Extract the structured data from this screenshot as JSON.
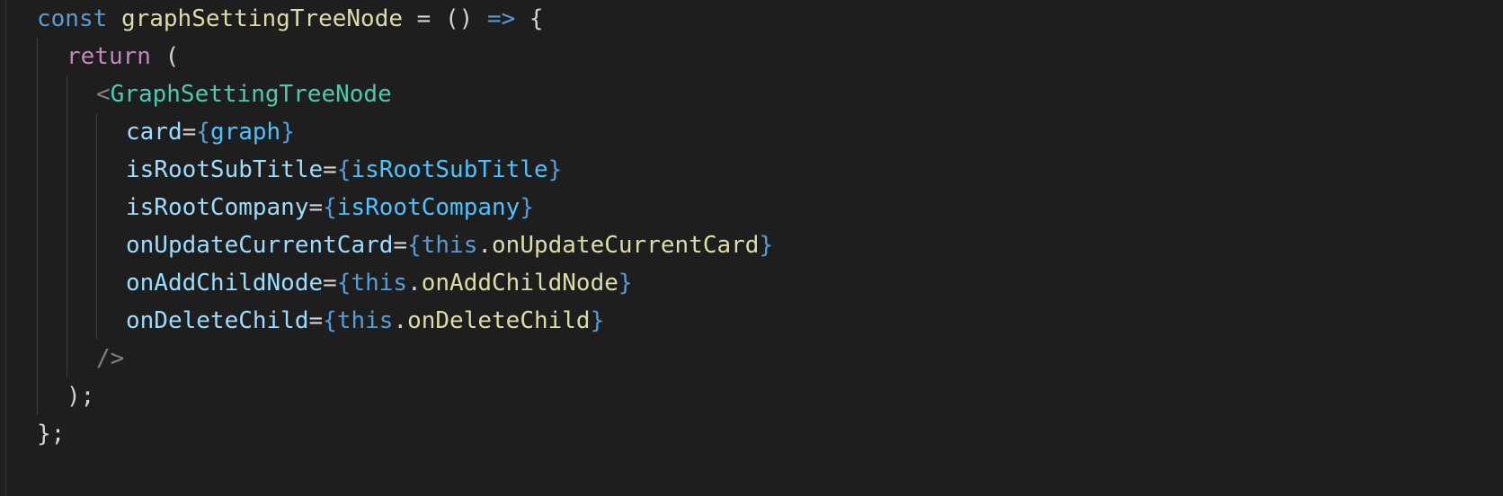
{
  "editor": {
    "colors": {
      "background": "#1e1e1e",
      "keyword_blue": "#569cd6",
      "keyword_purple": "#c586c0",
      "function_yellow": "#dcdcaa",
      "component_teal": "#4ec9b0",
      "attribute_lightblue": "#9cdcfe",
      "brace_blue": "#569cd6",
      "punctuation": "#d4d4d4",
      "tag_bracket": "#808080"
    },
    "lines": [
      {
        "indent": 0,
        "tokens": [
          {
            "text": "const",
            "color": "#569cd6"
          },
          {
            "text": " ",
            "color": "#d4d4d4"
          },
          {
            "text": "graphSettingTreeNode",
            "color": "#dcdcaa"
          },
          {
            "text": " = () ",
            "color": "#d4d4d4"
          },
          {
            "text": "=>",
            "color": "#569cd6"
          },
          {
            "text": " {",
            "color": "#d4d4d4"
          }
        ]
      },
      {
        "indent": 1,
        "tokens": [
          {
            "text": "return",
            "color": "#c586c0"
          },
          {
            "text": " (",
            "color": "#d4d4d4"
          }
        ]
      },
      {
        "indent": 2,
        "tokens": [
          {
            "text": "<",
            "color": "#808080"
          },
          {
            "text": "GraphSettingTreeNode",
            "color": "#4ec9b0"
          }
        ]
      },
      {
        "indent": 3,
        "tokens": [
          {
            "text": "card",
            "color": "#9cdcfe"
          },
          {
            "text": "=",
            "color": "#d4d4d4"
          },
          {
            "text": "{",
            "color": "#569cd6"
          },
          {
            "text": "graph",
            "color": "#4fc1ff"
          },
          {
            "text": "}",
            "color": "#569cd6"
          }
        ]
      },
      {
        "indent": 3,
        "tokens": [
          {
            "text": "isRootSubTitle",
            "color": "#9cdcfe"
          },
          {
            "text": "=",
            "color": "#d4d4d4"
          },
          {
            "text": "{",
            "color": "#569cd6"
          },
          {
            "text": "isRootSubTitle",
            "color": "#4fc1ff"
          },
          {
            "text": "}",
            "color": "#569cd6"
          }
        ]
      },
      {
        "indent": 3,
        "tokens": [
          {
            "text": "isRootCompany",
            "color": "#9cdcfe"
          },
          {
            "text": "=",
            "color": "#d4d4d4"
          },
          {
            "text": "{",
            "color": "#569cd6"
          },
          {
            "text": "isRootCompany",
            "color": "#4fc1ff"
          },
          {
            "text": "}",
            "color": "#569cd6"
          }
        ]
      },
      {
        "indent": 3,
        "tokens": [
          {
            "text": "onUpdateCurrentCard",
            "color": "#9cdcfe"
          },
          {
            "text": "=",
            "color": "#d4d4d4"
          },
          {
            "text": "{",
            "color": "#569cd6"
          },
          {
            "text": "this",
            "color": "#569cd6"
          },
          {
            "text": ".",
            "color": "#d4d4d4"
          },
          {
            "text": "onUpdateCurrentCard",
            "color": "#dcdcaa"
          },
          {
            "text": "}",
            "color": "#569cd6"
          }
        ]
      },
      {
        "indent": 3,
        "tokens": [
          {
            "text": "onAddChildNode",
            "color": "#9cdcfe"
          },
          {
            "text": "=",
            "color": "#d4d4d4"
          },
          {
            "text": "{",
            "color": "#569cd6"
          },
          {
            "text": "this",
            "color": "#569cd6"
          },
          {
            "text": ".",
            "color": "#d4d4d4"
          },
          {
            "text": "onAddChildNode",
            "color": "#dcdcaa"
          },
          {
            "text": "}",
            "color": "#569cd6"
          }
        ]
      },
      {
        "indent": 3,
        "tokens": [
          {
            "text": "onDeleteChild",
            "color": "#9cdcfe"
          },
          {
            "text": "=",
            "color": "#d4d4d4"
          },
          {
            "text": "{",
            "color": "#569cd6"
          },
          {
            "text": "this",
            "color": "#569cd6"
          },
          {
            "text": ".",
            "color": "#d4d4d4"
          },
          {
            "text": "onDeleteChild",
            "color": "#dcdcaa"
          },
          {
            "text": "}",
            "color": "#569cd6"
          }
        ]
      },
      {
        "indent": 2,
        "tokens": [
          {
            "text": "/>",
            "color": "#808080"
          }
        ]
      },
      {
        "indent": 1,
        "tokens": [
          {
            "text": ");",
            "color": "#d4d4d4"
          }
        ]
      },
      {
        "indent": 0,
        "tokens": [
          {
            "text": "};",
            "color": "#d4d4d4"
          }
        ]
      }
    ]
  }
}
